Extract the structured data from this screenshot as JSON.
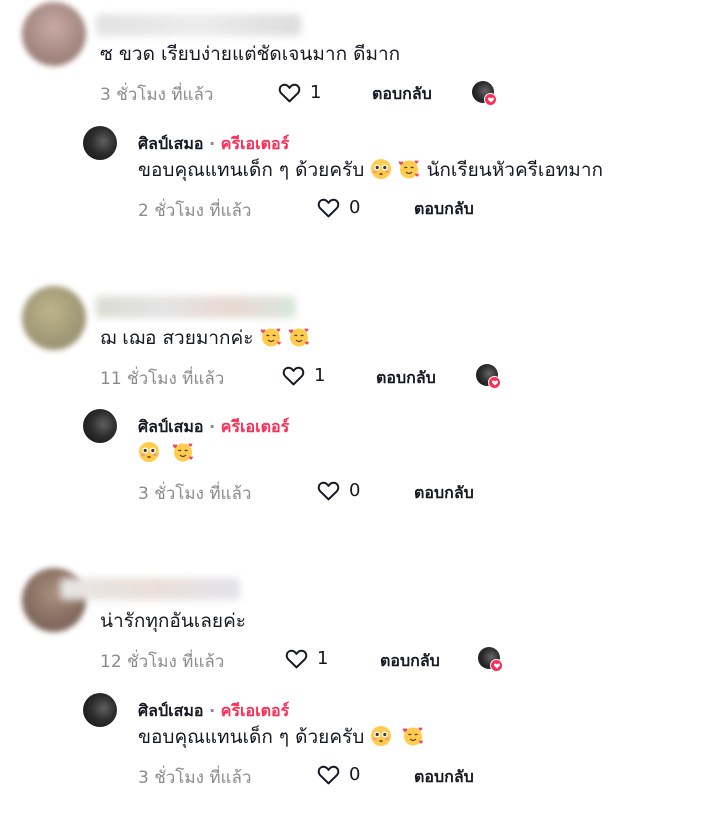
{
  "colors": {
    "accent": "#fe2c55",
    "muted": "#8a8b91",
    "text": "#161823"
  },
  "comments": [
    {
      "text": "ซ ขวด เรียบง่ายแต่ชัดเจนมาก ดีมาก",
      "time": "3 ชั่วโมง ที่แล้ว",
      "likes": "1",
      "reply_label": "ตอบกลับ",
      "reply": {
        "author": "ศิลป์เสมอ",
        "sep": "·",
        "role": "ครีเอเตอร์",
        "text": "ขอบคุณแทนเด็ก ๆ ด้วยครับ",
        "text_after": "นักเรียนหัวครีเอทมาก",
        "time": "2 ชั่วโมง ที่แล้ว",
        "likes": "0",
        "reply_label": "ตอบกลับ"
      }
    },
    {
      "text": "ฌ เฌอ สวยมากค่ะ",
      "time": "11 ชั่วโมง ที่แล้ว",
      "likes": "1",
      "reply_label": "ตอบกลับ",
      "reply": {
        "author": "ศิลป์เสมอ",
        "sep": "·",
        "role": "ครีเอเตอร์",
        "text": "",
        "time": "3 ชั่วโมง ที่แล้ว",
        "likes": "0",
        "reply_label": "ตอบกลับ"
      }
    },
    {
      "text": "น่ารักทุกอันเลยค่ะ",
      "time": "12 ชั่วโมง ที่แล้ว",
      "likes": "1",
      "reply_label": "ตอบกลับ",
      "reply": {
        "author": "ศิลป์เสมอ",
        "sep": "·",
        "role": "ครีเอเตอร์",
        "text": "ขอบคุณแทนเด็ก ๆ ด้วยครับ",
        "time": "3 ชั่วโมง ที่แล้ว",
        "likes": "0",
        "reply_label": "ตอบกลับ"
      }
    }
  ],
  "icons": {
    "like": "heart-outline-icon",
    "liked_badge": "heart-badge-icon",
    "flushed": "flushed-face-emoji",
    "hearts": "smiling-face-with-hearts-emoji"
  }
}
